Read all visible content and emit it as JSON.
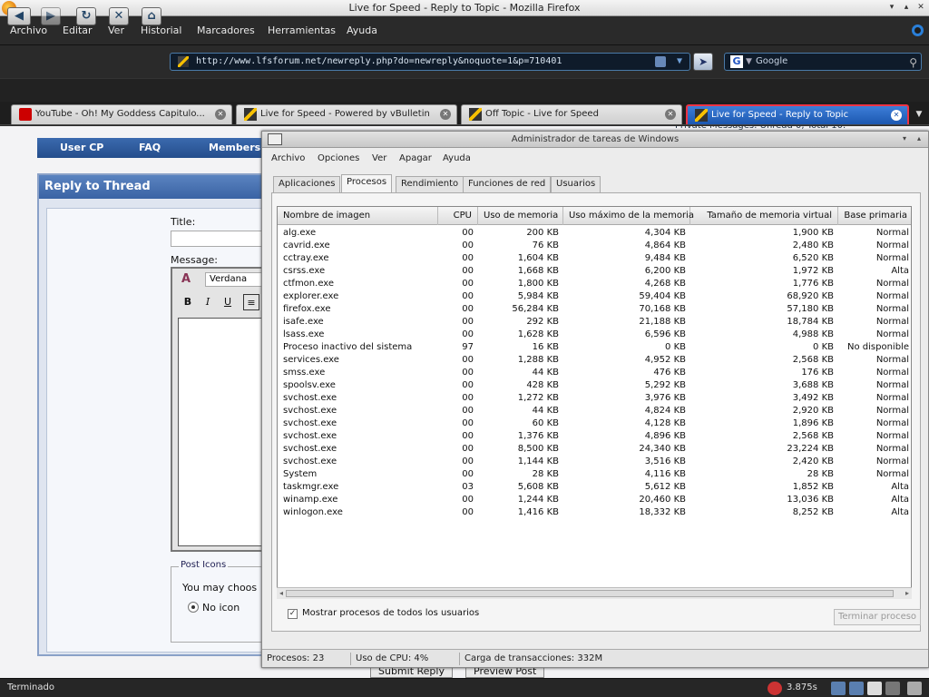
{
  "window": {
    "title": "Live for Speed - Reply to Topic - Mozilla Firefox",
    "controls": [
      "▾",
      "▴",
      "✕"
    ]
  },
  "menu": [
    "Archivo",
    "Editar",
    "Ver",
    "Historial",
    "Marcadores",
    "Herramientas",
    "Ayuda"
  ],
  "nav": {
    "url": "http://www.lfsforum.net/newreply.php?do=newreply&noquote=1&p=710401",
    "search_engine": "Google",
    "back_icon": "back-arrow-icon",
    "forward_icon": "forward-arrow-icon",
    "reload_icon": "reload-icon",
    "stop_icon": "stop-icon",
    "home_icon": "home-icon"
  },
  "tabs": [
    {
      "label": "YouTube - Oh! My Goddess Capitulo...",
      "icon": "youtube-icon"
    },
    {
      "label": "Live for Speed - Powered by vBulletin",
      "icon": "lfs-icon"
    },
    {
      "label": "Off Topic - Live for Speed",
      "icon": "lfs-icon"
    },
    {
      "label": "Live for Speed - Reply to Topic",
      "icon": "lfs-icon",
      "active": true
    }
  ],
  "forum": {
    "nav": [
      "User CP",
      "FAQ",
      "Members L"
    ],
    "pm_partial": "Private Messages: Unread 0, Total 10.",
    "reply_title": "Reply to Thread",
    "title_label": "Title:",
    "message_label": "Message:",
    "font": "Verdana",
    "editor_buttons": [
      "B",
      "I",
      "U"
    ],
    "post_icons_legend": "Post Icons",
    "post_icons_text": "You may choos",
    "no_icon_label": "No icon",
    "submit": "Submit Reply",
    "preview": "Preview Post"
  },
  "taskmgr": {
    "title": "Administrador de tareas de Windows",
    "menu": [
      "Archivo",
      "Opciones",
      "Ver",
      "Apagar",
      "Ayuda"
    ],
    "tabs": [
      "Aplicaciones",
      "Procesos",
      "Rendimiento",
      "Funciones de red",
      "Usuarios"
    ],
    "active_tab": "Procesos",
    "columns": [
      "Nombre de imagen",
      "CPU",
      "Uso de memoria",
      "Uso máximo de la memoria",
      "Tamaño de memoria virtual",
      "Base primaria"
    ],
    "processes": [
      [
        "alg.exe",
        "00",
        "200 KB",
        "4,304 KB",
        "1,900 KB",
        "Normal"
      ],
      [
        "cavrid.exe",
        "00",
        "76 KB",
        "4,864 KB",
        "2,480 KB",
        "Normal"
      ],
      [
        "cctray.exe",
        "00",
        "1,604 KB",
        "9,484 KB",
        "6,520 KB",
        "Normal"
      ],
      [
        "csrss.exe",
        "00",
        "1,668 KB",
        "6,200 KB",
        "1,972 KB",
        "Alta"
      ],
      [
        "ctfmon.exe",
        "00",
        "1,800 KB",
        "4,268 KB",
        "1,776 KB",
        "Normal"
      ],
      [
        "explorer.exe",
        "00",
        "5,984 KB",
        "59,404 KB",
        "68,920 KB",
        "Normal"
      ],
      [
        "firefox.exe",
        "00",
        "56,284 KB",
        "70,168 KB",
        "57,180 KB",
        "Normal"
      ],
      [
        "isafe.exe",
        "00",
        "292 KB",
        "21,188 KB",
        "18,784 KB",
        "Normal"
      ],
      [
        "lsass.exe",
        "00",
        "1,628 KB",
        "6,596 KB",
        "4,988 KB",
        "Normal"
      ],
      [
        "Proceso inactivo del sistema",
        "97",
        "16 KB",
        "0 KB",
        "0 KB",
        "No disponible"
      ],
      [
        "services.exe",
        "00",
        "1,288 KB",
        "4,952 KB",
        "2,568 KB",
        "Normal"
      ],
      [
        "smss.exe",
        "00",
        "44 KB",
        "476 KB",
        "176 KB",
        "Normal"
      ],
      [
        "spoolsv.exe",
        "00",
        "428 KB",
        "5,292 KB",
        "3,688 KB",
        "Normal"
      ],
      [
        "svchost.exe",
        "00",
        "1,272 KB",
        "3,976 KB",
        "3,492 KB",
        "Normal"
      ],
      [
        "svchost.exe",
        "00",
        "44 KB",
        "4,824 KB",
        "2,920 KB",
        "Normal"
      ],
      [
        "svchost.exe",
        "00",
        "60 KB",
        "4,128 KB",
        "1,896 KB",
        "Normal"
      ],
      [
        "svchost.exe",
        "00",
        "1,376 KB",
        "4,896 KB",
        "2,568 KB",
        "Normal"
      ],
      [
        "svchost.exe",
        "00",
        "8,500 KB",
        "24,340 KB",
        "23,224 KB",
        "Normal"
      ],
      [
        "svchost.exe",
        "00",
        "1,144 KB",
        "3,516 KB",
        "2,420 KB",
        "Normal"
      ],
      [
        "System",
        "00",
        "28 KB",
        "4,116 KB",
        "28 KB",
        "Normal"
      ],
      [
        "taskmgr.exe",
        "03",
        "5,608 KB",
        "5,612 KB",
        "1,852 KB",
        "Alta"
      ],
      [
        "winamp.exe",
        "00",
        "1,244 KB",
        "20,460 KB",
        "13,036 KB",
        "Alta"
      ],
      [
        "winlogon.exe",
        "00",
        "1,416 KB",
        "18,332 KB",
        "8,252 KB",
        "Alta"
      ]
    ],
    "show_all_label": "Mostrar procesos de todos los usuarios",
    "show_all_checked": true,
    "end_process": "Terminar proceso",
    "status": {
      "processes": "Procesos: 23",
      "cpu": "Uso de CPU: 4%",
      "commit": "Carga de transacciones: 332M"
    }
  },
  "statusbar": {
    "text": "Terminado",
    "load_time": "3.875s"
  }
}
